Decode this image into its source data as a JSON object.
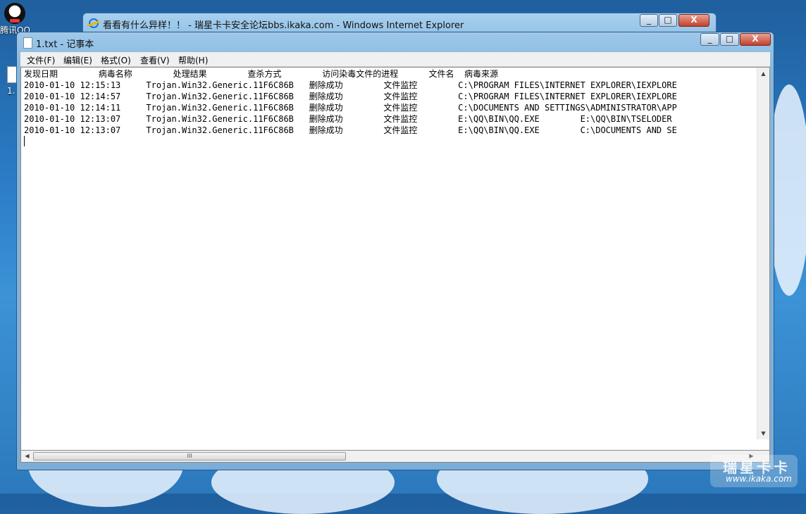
{
  "desktop": {
    "qq_label": "腾讯QQ",
    "file_label": "1."
  },
  "ie_window": {
    "title": "看看有什么异样！！ - 瑞星卡卡安全论坛bbs.ikaka.com - Windows Internet Explorer",
    "minimize": "_",
    "maximize": "□",
    "close": "X"
  },
  "notepad": {
    "title": "1.txt - 记事本",
    "minimize": "_",
    "maximize": "□",
    "close": "X",
    "menu": [
      "文件(F)",
      "编辑(E)",
      "格式(O)",
      "查看(V)",
      "帮助(H)"
    ],
    "header": "发现日期        病毒名称        处理结果        查杀方式        访问染毒文件的进程      文件名  病毒来源",
    "lines": [
      "2010-01-10 12:15:13     Trojan.Win32.Generic.11F6C86B   删除成功        文件监控        C:\\PROGRAM FILES\\INTERNET EXPLORER\\IEXPLORE",
      "2010-01-10 12:14:57     Trojan.Win32.Generic.11F6C86B   删除成功        文件监控        C:\\PROGRAM FILES\\INTERNET EXPLORER\\IEXPLORE",
      "2010-01-10 12:14:11     Trojan.Win32.Generic.11F6C86B   删除成功        文件监控        C:\\DOCUMENTS AND SETTINGS\\ADMINISTRATOR\\APP",
      "2010-01-10 12:13:07     Trojan.Win32.Generic.11F6C86B   删除成功        文件监控        E:\\QQ\\BIN\\QQ.EXE        E:\\QQ\\BIN\\TSELODER",
      "2010-01-10 12:13:07     Trojan.Win32.Generic.11F6C86B   删除成功        文件监控        E:\\QQ\\BIN\\QQ.EXE        C:\\DOCUMENTS AND SE"
    ],
    "scroll_thumb_grip": "III"
  },
  "watermark": {
    "main": "瑞星卡卡",
    "url": "www.ikaka.com"
  }
}
